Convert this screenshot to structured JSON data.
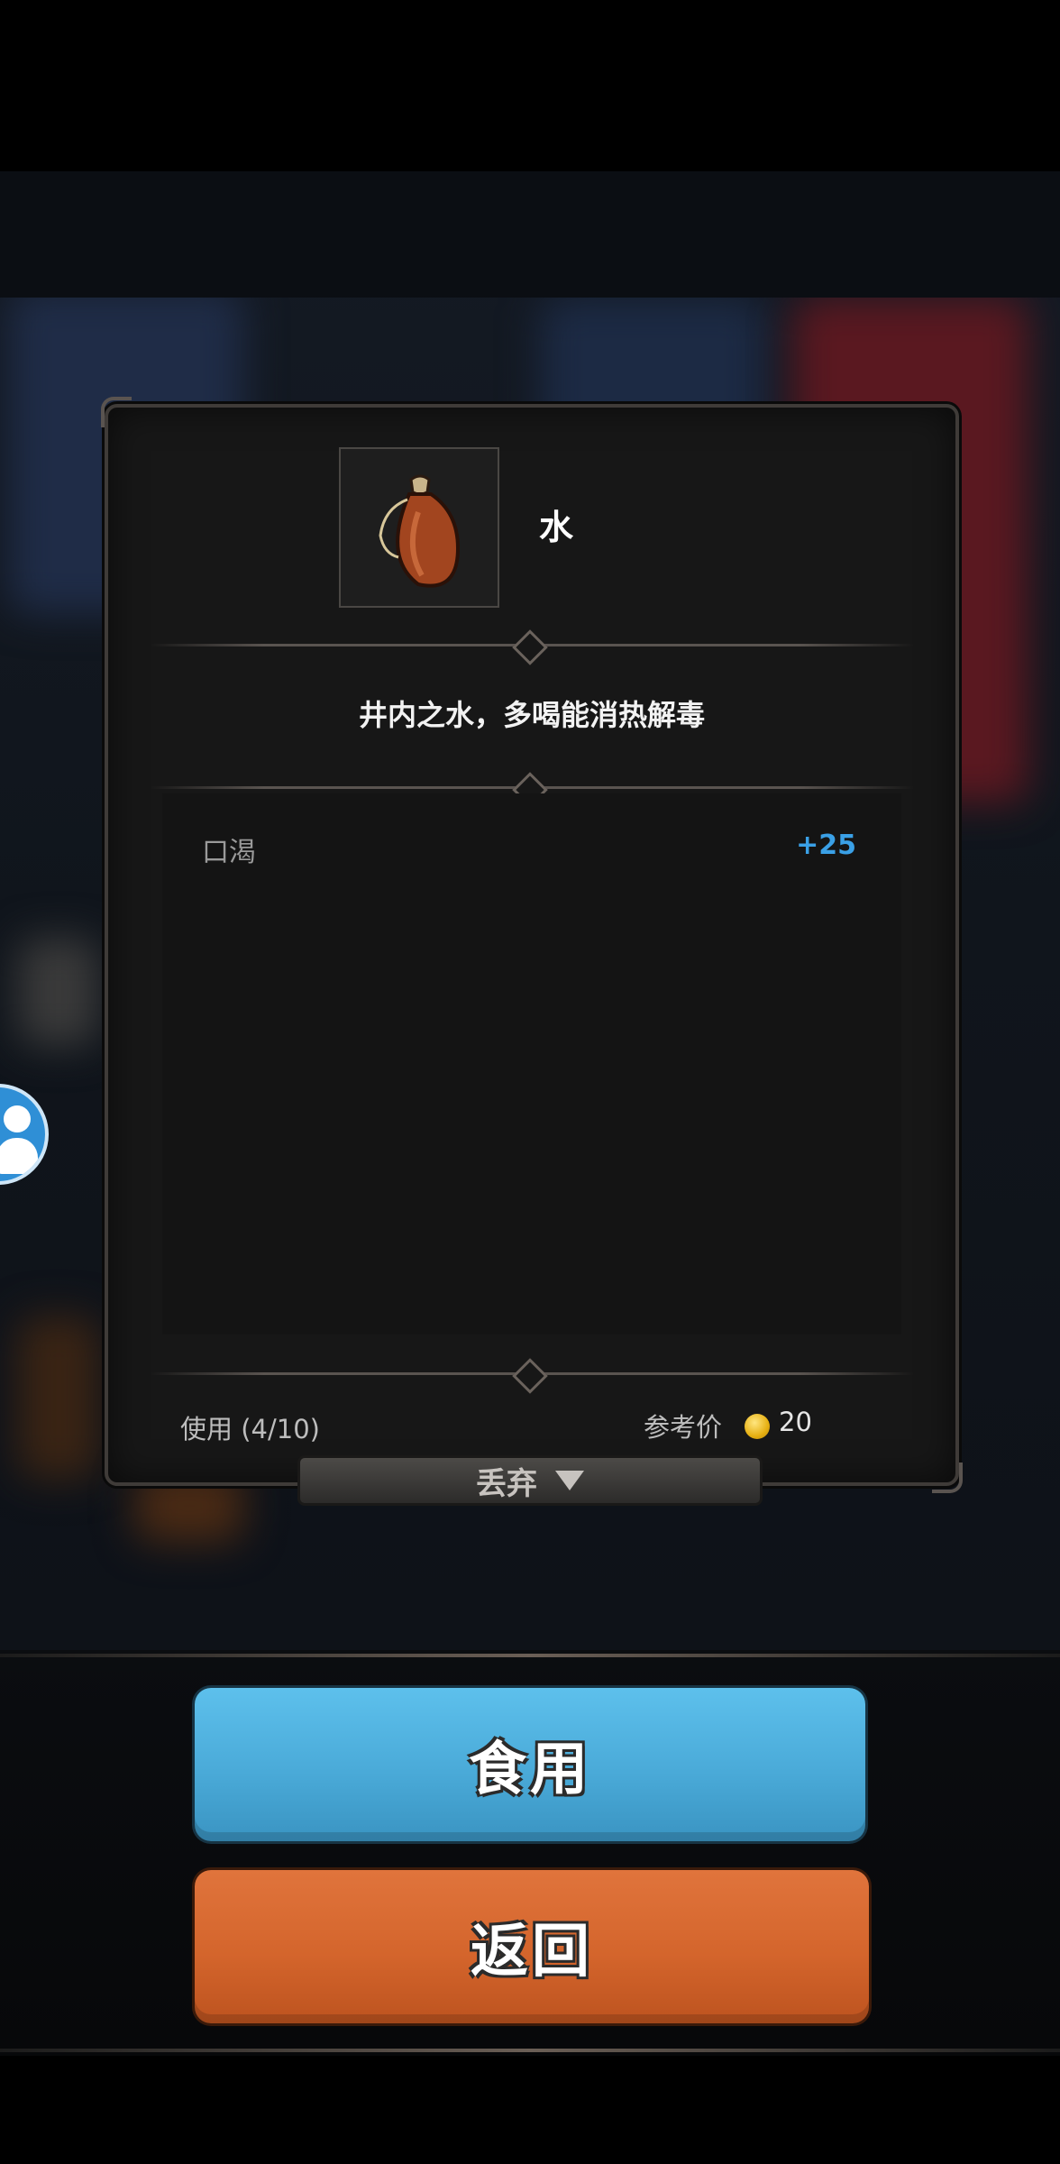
{
  "item": {
    "name": "水",
    "icon": "water-gourd-icon",
    "description": "井内之水，多喝能消热解毒"
  },
  "stats": [
    {
      "label": "口渴",
      "value": "+25"
    }
  ],
  "footer": {
    "usage": "使用 (4/10)",
    "price_label": "参考价",
    "price_value": "20"
  },
  "discard_label": "丢弃",
  "buttons": {
    "eat": "食用",
    "back": "返回"
  },
  "colors": {
    "stat_value": "#3aa0e6",
    "eat_button": "#4aaad8",
    "back_button": "#d4652c"
  }
}
